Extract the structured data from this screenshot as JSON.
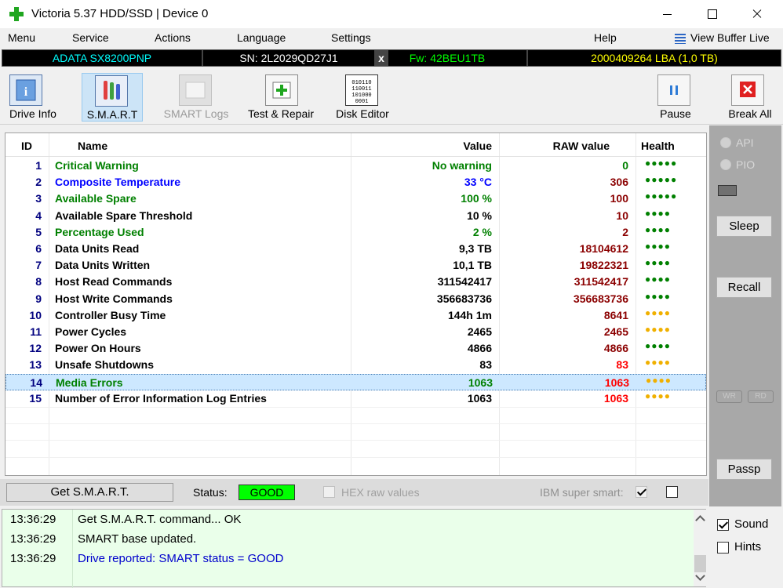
{
  "window": {
    "title": "Victoria 5.37 HDD/SSD | Device 0"
  },
  "menu": {
    "items": [
      "Menu",
      "Service",
      "Actions",
      "Language",
      "Settings",
      "Help"
    ],
    "view_buffer": "View Buffer Live"
  },
  "device": {
    "model": "ADATA SX8200PNP",
    "serial": "SN: 2L2029QD27J1",
    "close": "x",
    "firmware": "Fw: 42BEU1TB",
    "capacity": "2000409264 LBA (1,0 TB)",
    "colors": {
      "model": "#00ffff",
      "serial": "#ffffff",
      "firmware": "#00ff00",
      "capacity": "#ffff00"
    }
  },
  "toolbar": {
    "drive_info": "Drive Info",
    "smart": "S.M.A.R.T",
    "smart_logs": "SMART Logs",
    "test_repair": "Test & Repair",
    "disk_editor": "Disk Editor",
    "disk_editor_icon_text": "010110 110011 101000 0001",
    "pause": "Pause",
    "break_all": "Break All"
  },
  "table": {
    "headers": {
      "id": "ID",
      "name": "Name",
      "value": "Value",
      "raw": "RAW value",
      "health": "Health"
    },
    "rows": [
      {
        "id": "1",
        "name": "Critical Warning",
        "value": "No warning",
        "raw": "0",
        "health": "●●●●●",
        "name_color": "#008000",
        "value_color": "#008000",
        "raw_color": "#008000",
        "health_color": "#008000"
      },
      {
        "id": "2",
        "name": "Composite Temperature",
        "value": "33 °C",
        "raw": "306",
        "health": "●●●●●",
        "name_color": "#0000ff",
        "value_color": "#0000ff",
        "raw_color": "#8b0000",
        "health_color": "#008000"
      },
      {
        "id": "3",
        "name": "Available Spare",
        "value": "100 %",
        "raw": "100",
        "health": "●●●●●",
        "name_color": "#008000",
        "value_color": "#008000",
        "raw_color": "#8b0000",
        "health_color": "#008000"
      },
      {
        "id": "4",
        "name": "Available Spare Threshold",
        "value": "10 %",
        "raw": "10",
        "health": "●●●●",
        "name_color": "#000000",
        "value_color": "#000000",
        "raw_color": "#8b0000",
        "health_color": "#008000"
      },
      {
        "id": "5",
        "name": "Percentage Used",
        "value": "2 %",
        "raw": "2",
        "health": "●●●●",
        "name_color": "#008000",
        "value_color": "#008000",
        "raw_color": "#8b0000",
        "health_color": "#008000"
      },
      {
        "id": "6",
        "name": "Data Units Read",
        "value": "9,3 TB",
        "raw": "18104612",
        "health": "●●●●",
        "name_color": "#000000",
        "value_color": "#000000",
        "raw_color": "#8b0000",
        "health_color": "#008000"
      },
      {
        "id": "7",
        "name": "Data Units Written",
        "value": "10,1 TB",
        "raw": "19822321",
        "health": "●●●●",
        "name_color": "#000000",
        "value_color": "#000000",
        "raw_color": "#8b0000",
        "health_color": "#008000"
      },
      {
        "id": "8",
        "name": "Host Read Commands",
        "value": "311542417",
        "raw": "311542417",
        "health": "●●●●",
        "name_color": "#000000",
        "value_color": "#000000",
        "raw_color": "#8b0000",
        "health_color": "#008000"
      },
      {
        "id": "9",
        "name": "Host Write Commands",
        "value": "356683736",
        "raw": "356683736",
        "health": "●●●●",
        "name_color": "#000000",
        "value_color": "#000000",
        "raw_color": "#8b0000",
        "health_color": "#008000"
      },
      {
        "id": "10",
        "name": "Controller Busy Time",
        "value": "144h 1m",
        "raw": "8641",
        "health": "●●●●",
        "name_color": "#000000",
        "value_color": "#000000",
        "raw_color": "#8b0000",
        "health_color": "#f0b000"
      },
      {
        "id": "11",
        "name": "Power Cycles",
        "value": "2465",
        "raw": "2465",
        "health": "●●●●",
        "name_color": "#000000",
        "value_color": "#000000",
        "raw_color": "#8b0000",
        "health_color": "#f0b000"
      },
      {
        "id": "12",
        "name": "Power On Hours",
        "value": "4866",
        "raw": "4866",
        "health": "●●●●",
        "name_color": "#000000",
        "value_color": "#000000",
        "raw_color": "#8b0000",
        "health_color": "#008000"
      },
      {
        "id": "13",
        "name": "Unsafe Shutdowns",
        "value": "83",
        "raw": "83",
        "health": "●●●●",
        "name_color": "#000000",
        "value_color": "#000000",
        "raw_color": "#ff0000",
        "health_color": "#f0b000"
      },
      {
        "id": "14",
        "name": "Media Errors",
        "value": "1063",
        "raw": "1063",
        "health": "●●●●",
        "name_color": "#008000",
        "value_color": "#008000",
        "raw_color": "#ff0000",
        "health_color": "#f0b000"
      },
      {
        "id": "15",
        "name": "Number of Error Information Log Entries",
        "value": "1063",
        "raw": "1063",
        "health": "●●●●",
        "name_color": "#000000",
        "value_color": "#000000",
        "raw_color": "#ff0000",
        "health_color": "#f0b000"
      }
    ],
    "selected_row": 13
  },
  "side": {
    "api": "API",
    "pio": "PIO",
    "sleep": "Sleep",
    "recall": "Recall",
    "wr": "WR",
    "rd": "RD",
    "passp": "Passp"
  },
  "status": {
    "get_smart": "Get S.M.A.R.T.",
    "label": "Status:",
    "value": "GOOD",
    "hex_raw": "HEX raw values",
    "ibm": "IBM super smart:"
  },
  "log": [
    {
      "time": "13:36:29",
      "msg": "Get S.M.A.R.T. command... OK",
      "color": "#000000"
    },
    {
      "time": "13:36:29",
      "msg": "SMART base updated.",
      "color": "#000000"
    },
    {
      "time": "13:36:29",
      "msg": "Drive reported: SMART status = GOOD",
      "color": "#0000cc"
    }
  ],
  "options": {
    "sound": "Sound",
    "hints": "Hints"
  }
}
